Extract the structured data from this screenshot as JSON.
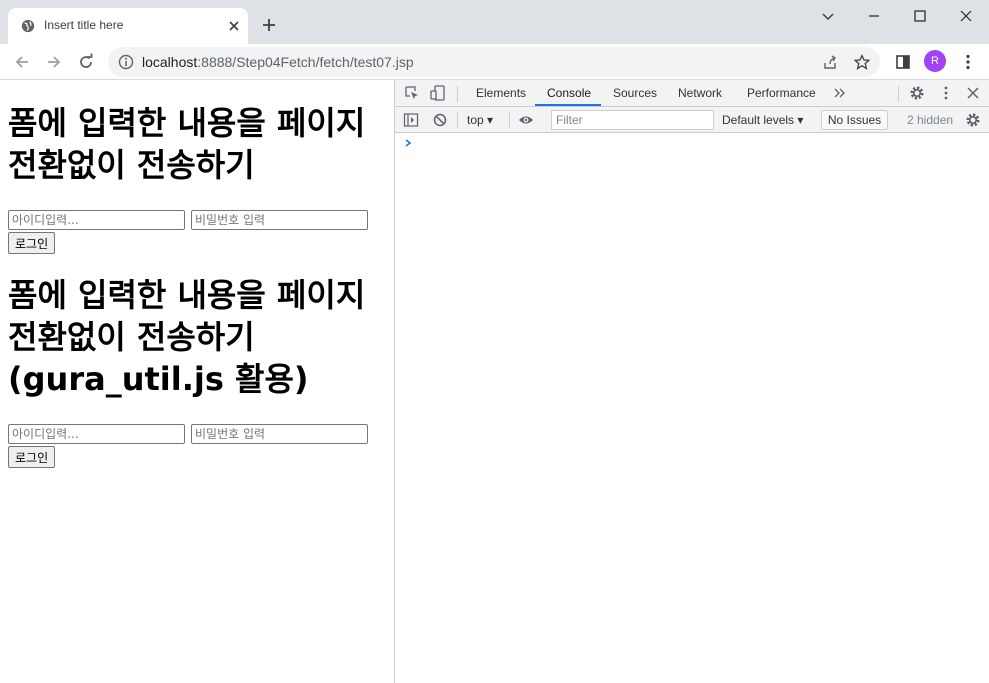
{
  "browser": {
    "tab_title": "Insert title here",
    "url_host": "localhost",
    "url_path": ":8888/Step04Fetch/fetch/test07.jsp",
    "profile_initial": "R",
    "accent": "#a142f4"
  },
  "page": {
    "section1": {
      "heading": "폼에 입력한 내용을 페이지 전환없이 전송하기",
      "id_placeholder": "아이디입력...",
      "pwd_placeholder": "비밀번호 입력",
      "submit_label": "로그인"
    },
    "section2": {
      "heading": "폼에 입력한 내용을 페이지 전환없이 전송하기 (gura_util.js 활용)",
      "id_placeholder": "아이디입력...",
      "pwd_placeholder": "비밀번호 입력",
      "submit_label": "로그인"
    }
  },
  "devtools": {
    "tabs": [
      "Elements",
      "Console",
      "Sources",
      "Network",
      "Performance"
    ],
    "active_tab": "Console",
    "context": "top",
    "filter_placeholder": "Filter",
    "levels_label": "Default levels",
    "issues_label": "No Issues",
    "hidden_label": "2 hidden",
    "accent": "#1a73e8"
  }
}
